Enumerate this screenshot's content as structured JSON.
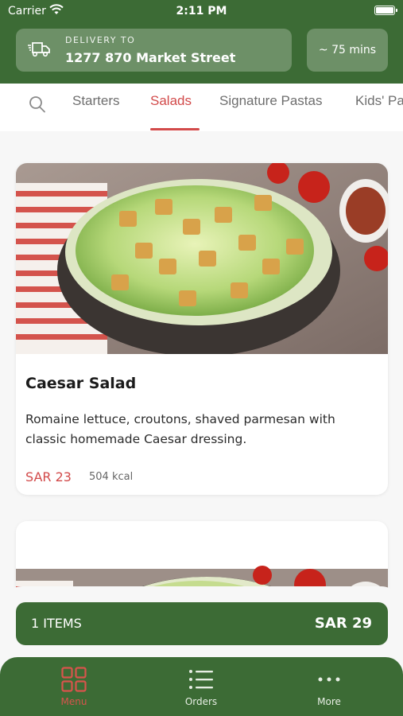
{
  "status_bar": {
    "carrier": "Carrier",
    "time": "2:11 PM"
  },
  "delivery": {
    "label": "DELIVERY TO",
    "address": "1277 870 Market Street",
    "eta": "~ 75 mins"
  },
  "categories": [
    {
      "label": "Starters",
      "active": false
    },
    {
      "label": "Salads",
      "active": true
    },
    {
      "label": "Signature Pastas",
      "active": false
    },
    {
      "label": "Kids' Pasta",
      "active": false
    }
  ],
  "menu_items": [
    {
      "name": "Caesar Salad",
      "description": "Romaine lettuce, croutons, shaved parmesan with classic homemade Caesar dressing.",
      "price": "SAR 23",
      "kcal": "504 kcal"
    }
  ],
  "cart": {
    "count": "1 ITEMS",
    "total": "SAR 29"
  },
  "nav": [
    {
      "label": "Menu",
      "icon": "grid-icon",
      "active": true
    },
    {
      "label": "Orders",
      "icon": "list-icon",
      "active": false
    },
    {
      "label": "More",
      "icon": "more-dots-icon",
      "active": false
    }
  ],
  "colors": {
    "brand_green": "#3c6b35",
    "accent_red": "#d24a4a",
    "background": "#f7f7f7"
  }
}
